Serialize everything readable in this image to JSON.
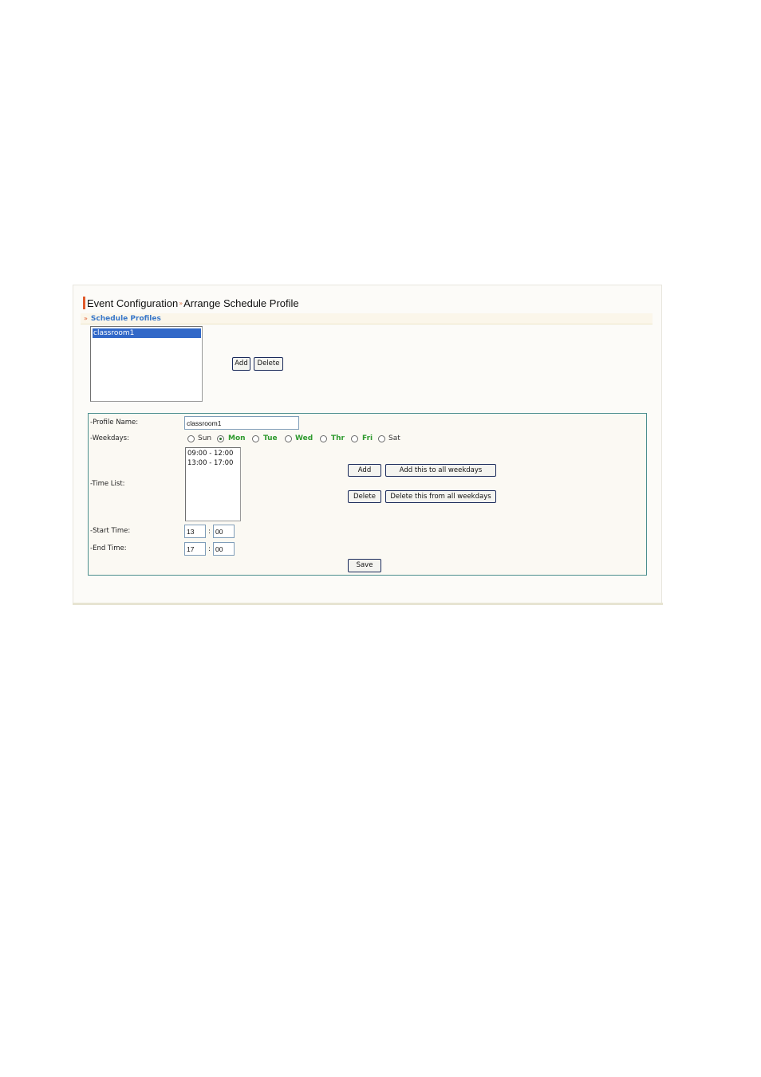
{
  "header": {
    "title": "Event Configuration",
    "separator": "»",
    "subtitle": "Arrange Schedule Profile"
  },
  "schedule_profiles": {
    "section_arrows": "»",
    "section_label": "Schedule Profiles",
    "items": [
      "classroom1"
    ],
    "selected": "classroom1",
    "add_label": "Add",
    "delete_label": "Delete"
  },
  "form": {
    "profile_name_label": "-Profile Name:",
    "profile_name_value": "classroom1",
    "weekdays_label": "-Weekdays:",
    "weekdays": [
      {
        "label": "Sun",
        "selected": false,
        "enabled": false
      },
      {
        "label": "Mon",
        "selected": true,
        "enabled": true
      },
      {
        "label": "Tue",
        "selected": false,
        "enabled": true
      },
      {
        "label": "Wed",
        "selected": false,
        "enabled": true
      },
      {
        "label": "Thr",
        "selected": false,
        "enabled": true
      },
      {
        "label": "Fri",
        "selected": false,
        "enabled": true
      },
      {
        "label": "Sat",
        "selected": false,
        "enabled": false
      }
    ],
    "time_list_label": "-Time List:",
    "time_list": [
      "09:00 - 12:00",
      "13:00 - 17:00"
    ],
    "add_label": "Add",
    "add_all_label": "Add this to all weekdays",
    "delete_label": "Delete",
    "delete_all_label": "Delete this from all weekdays",
    "start_time_label": "-Start Time:",
    "start_hour": "13",
    "start_minute": "00",
    "end_time_label": "-End Time:",
    "end_hour": "17",
    "end_minute": "00",
    "colon": ":",
    "save_label": "Save"
  },
  "colors": {
    "accent": "#e05a2b",
    "section_label": "#3a78c9",
    "enabled_day": "#2e9a2e",
    "selection": "#3168c8",
    "form_border": "#4b8e8e"
  }
}
